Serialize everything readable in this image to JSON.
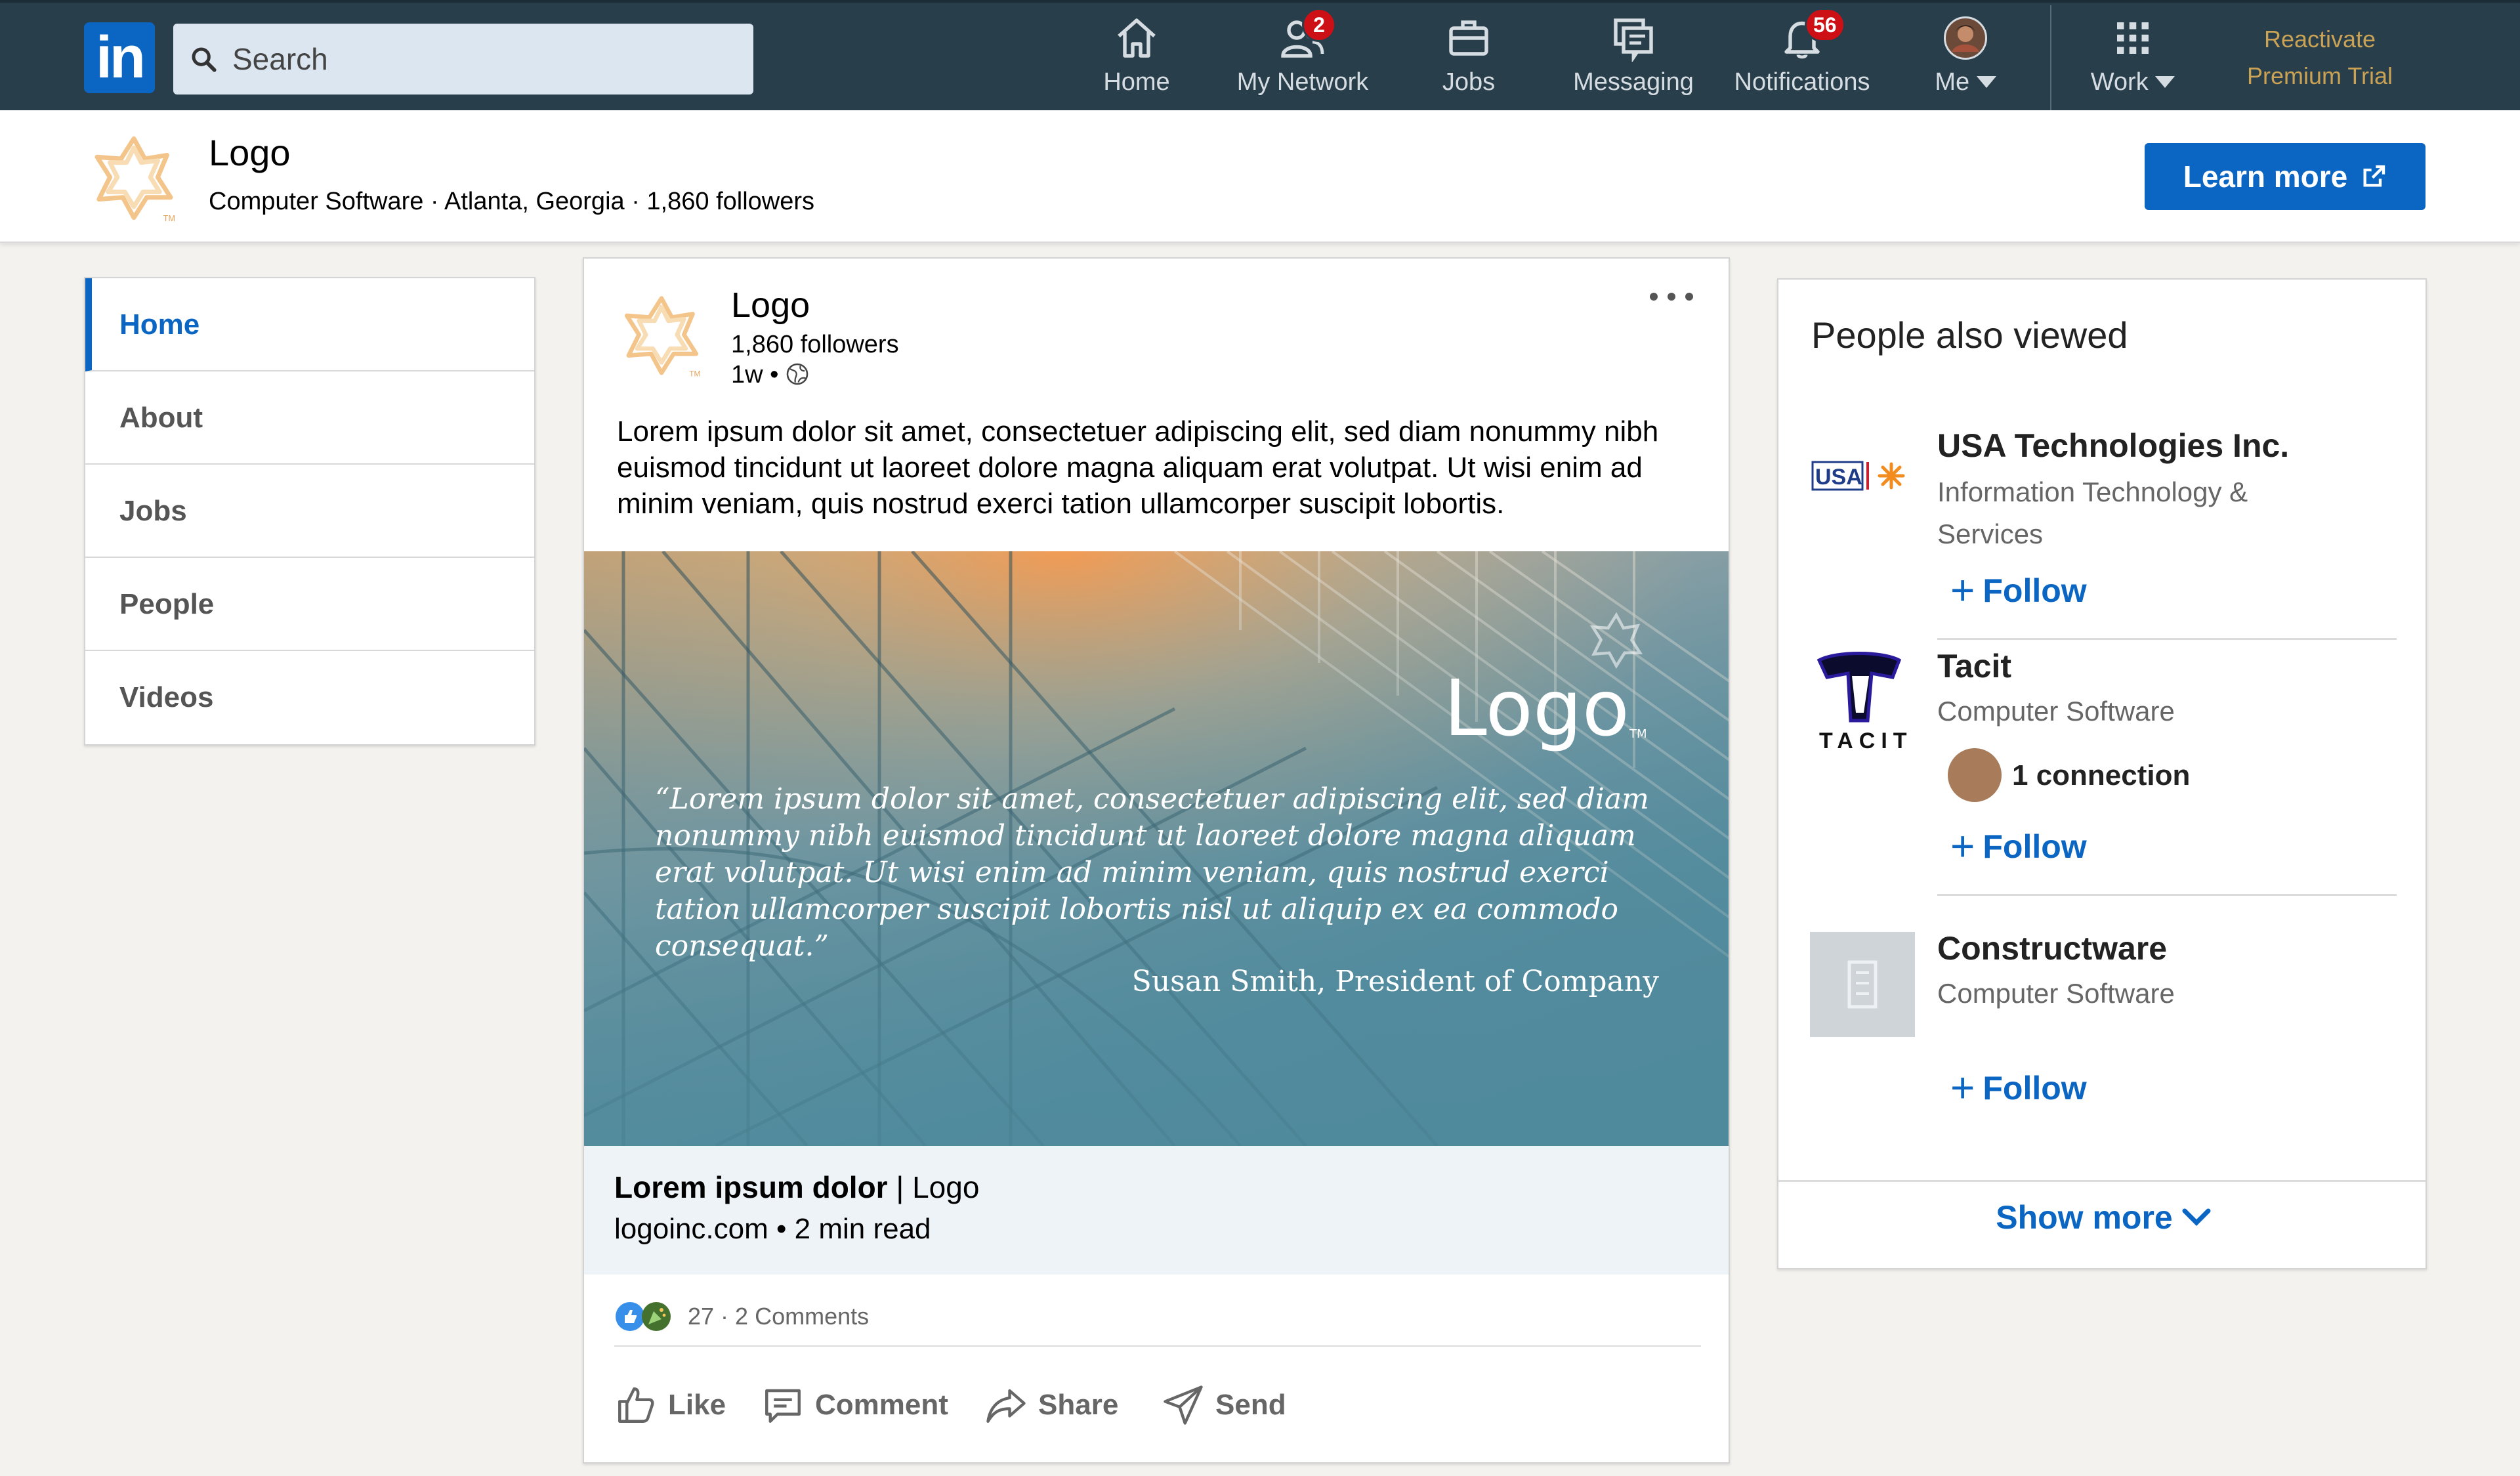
{
  "nav": {
    "search_placeholder": "Search",
    "items": [
      {
        "label": "Home",
        "icon": "home-icon"
      },
      {
        "label": "My Network",
        "icon": "network-icon",
        "badge": "2"
      },
      {
        "label": "Jobs",
        "icon": "briefcase-icon"
      },
      {
        "label": "Messaging",
        "icon": "messaging-icon"
      },
      {
        "label": "Notifications",
        "icon": "bell-icon",
        "badge": "56"
      },
      {
        "label": "Me",
        "icon": "avatar"
      },
      {
        "label": "Work",
        "icon": "grid-icon"
      }
    ],
    "premium_line1": "Reactivate",
    "premium_line2": "Premium Trial"
  },
  "company": {
    "name": "Logo",
    "meta": "Computer Software · Atlanta, Georgia · 1,860 followers",
    "cta": "Learn more"
  },
  "leftnav": {
    "items": [
      "Home",
      "About",
      "Jobs",
      "People",
      "Videos"
    ],
    "active": "Home"
  },
  "post": {
    "author": "Logo",
    "followers": "1,860 followers",
    "time": "1w •",
    "text": "Lorem ipsum dolor sit amet, consectetuer adipiscing elit, sed diam nonummy nibh euismod tincidunt ut laoreet dolore magna aliquam erat volutpat. Ut wisi enim ad minim veniam, quis nostrud exerci tation ullamcorper suscipit lobortis.",
    "image": {
      "logo_text": "Logo",
      "trademark": "TM",
      "quote": "“Lorem ipsum dolor sit amet, consectetuer adipiscing elit, sed diam nonummy nibh euismod tincidunt ut laoreet dolore magna aliquam erat volutpat. Ut wisi enim ad minim veniam, quis nostrud exerci tation ullamcorper suscipit lobortis nisl ut aliquip ex ea commodo consequat.”",
      "author": "Susan Smith, President of Company"
    },
    "article_title_bold": "Lorem ipsum dolor",
    "article_title_rest": " | Logo",
    "article_sub": "logoinc.com • 2 min read",
    "reactions": "27 · 2 Comments",
    "actions": [
      "Like",
      "Comment",
      "Share",
      "Send"
    ]
  },
  "sidebar": {
    "title": "People also viewed",
    "companies": [
      {
        "name": "USA Technologies Inc.",
        "industry": "Information Technology & Services",
        "follow": "Follow",
        "logo_text": "USA"
      },
      {
        "name": "Tacit",
        "industry": "Computer Software",
        "connection": "1 connection",
        "follow": "Follow",
        "logo_text": "TACIT"
      },
      {
        "name": "Constructware",
        "industry": "Computer Software",
        "follow": "Follow"
      }
    ],
    "show_more": "Show more"
  },
  "colors": {
    "nav_bg": "#283e4a",
    "brand_blue": "#0a66c2",
    "badge_red": "#cc1016",
    "premium_gold": "#c9a255"
  }
}
